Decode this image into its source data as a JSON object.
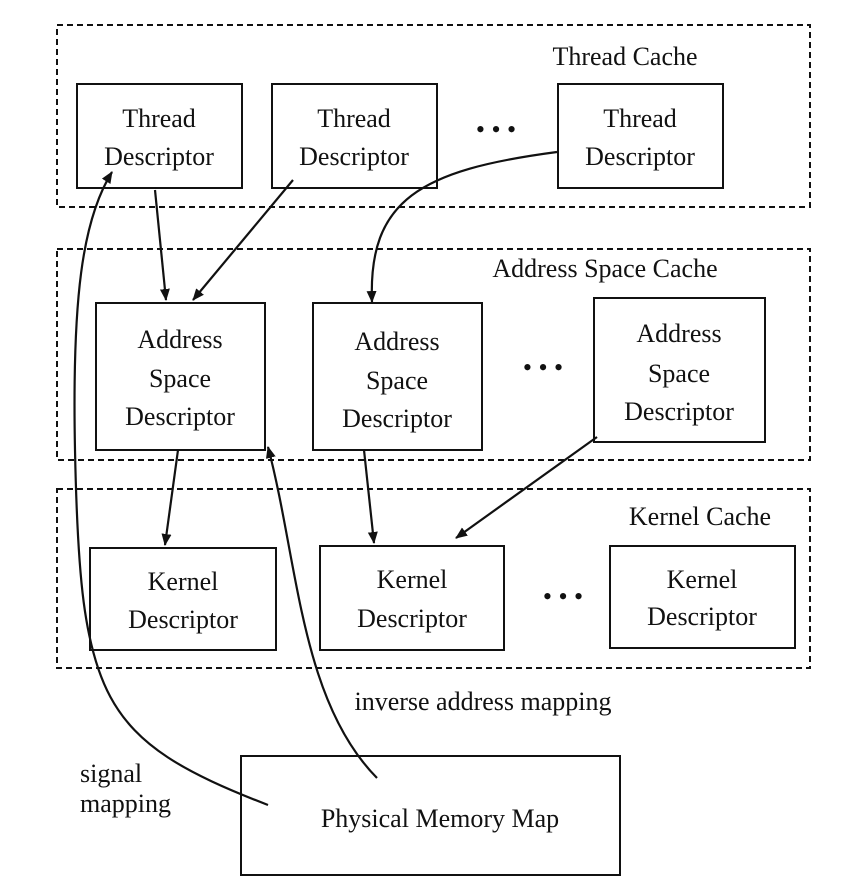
{
  "caches": {
    "thread": "Thread Cache",
    "address_space": "Address Space Cache",
    "kernel": "Kernel Cache"
  },
  "thread_descriptors": [
    [
      "Thread",
      "Descriptor"
    ],
    [
      "Thread",
      "Descriptor"
    ],
    [
      "Thread",
      "Descriptor"
    ]
  ],
  "address_space_descriptors": [
    [
      "Address",
      "Space",
      "Descriptor"
    ],
    [
      "Address",
      "Space",
      "Descriptor"
    ],
    [
      "Address",
      "Space",
      "Descriptor"
    ]
  ],
  "kernel_descriptors": [
    [
      "Kernel",
      "Descriptor"
    ],
    [
      "Kernel",
      "Descriptor"
    ],
    [
      "Kernel",
      "Descriptor"
    ]
  ],
  "ellipsis": "• • •",
  "physical_memory_map": "Physical Memory Map",
  "labels": {
    "inverse": "inverse address mapping",
    "signal_1": "signal",
    "signal_2": "mapping"
  }
}
